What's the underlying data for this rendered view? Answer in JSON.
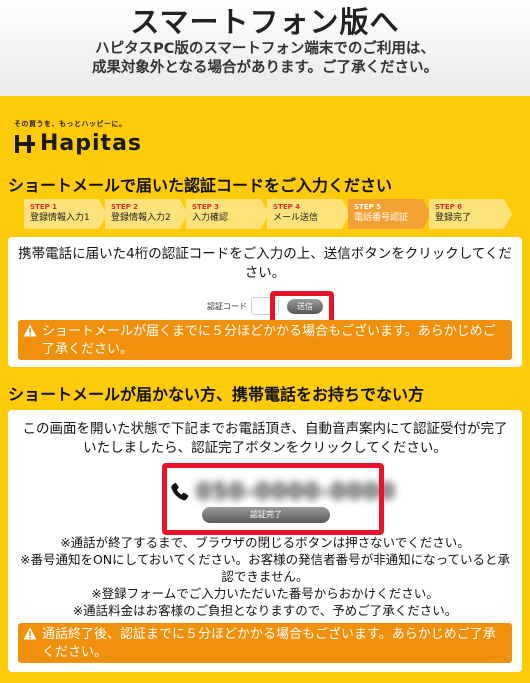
{
  "banner": {
    "title": "スマートフォン版へ",
    "line1": "ハピタスPC版のスマートフォン端末でのご利用は、",
    "line2": "成果対象外となる場合があります。ご了承ください。"
  },
  "logo": {
    "tagline": "その買うを、もっとハッピーに。",
    "brand": "Hapitas"
  },
  "section1": {
    "title": "ショートメールで届いた認証コードをご入力ください"
  },
  "steps": [
    {
      "num": "STEP 1",
      "label": "登録情報入力1"
    },
    {
      "num": "STEP 2",
      "label": "登録情報入力2"
    },
    {
      "num": "STEP 3",
      "label": "入力確認"
    },
    {
      "num": "STEP 4",
      "label": "メール送信"
    },
    {
      "num": "STEP 5",
      "label": "電話番号認証"
    },
    {
      "num": "STEP 6",
      "label": "登録完了"
    }
  ],
  "card1": {
    "message": "携帯電話に届いた4桁の認証コードをご入力の上、送信ボタンをクリックしてください。",
    "code_label": "認証コード",
    "send_label": "送信",
    "warning": "ショートメールが届くまでに５分ほどかかる場合もございます。あらかじめご了承ください。"
  },
  "section2": {
    "title": "ショートメールが届かない方、携帯電話をお持ちでない方"
  },
  "card2": {
    "message": "この画面を開いた状態で下記までお電話頂き、自動音声案内にて認証受付が完了いたしましたら、認証完了ボタンをクリックしてください。",
    "phone_number": "050-0000-0000",
    "complete_label": "認証完了",
    "notes": [
      "※通話が終了するまで、ブラウザの閉じるボタンは押さないでください。",
      "※番号通知をONにしておいてください。お客様の発信者番号が非通知になっていると承認できません。",
      "※登録フォームでご入力いただいた番号からおかけください。",
      "※通話料金はお客様のご負担となりますので、予めご了承ください。"
    ],
    "warning": "通話終了後、認証までに５分ほどかかる場合もございます。あらかじめご了承ください。"
  },
  "colors": {
    "background": "#fecb0a",
    "accent": "#f0900d",
    "active_step": "#f4a133",
    "highlight": "#e8132a"
  }
}
